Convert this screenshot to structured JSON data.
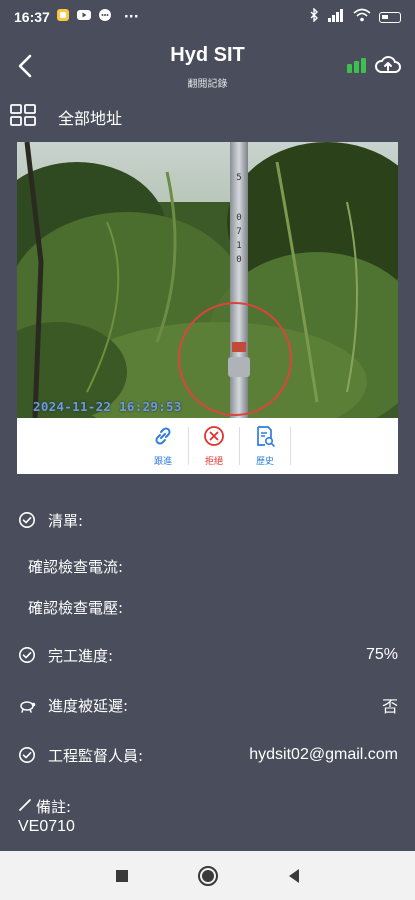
{
  "status_bar": {
    "time": "16:37",
    "more_indicator": "···",
    "icons": [
      "notification-app-icon",
      "youtube-icon",
      "chat-icon",
      "bluetooth-icon",
      "cellular-signal-icon",
      "wifi-icon",
      "battery-icon"
    ],
    "battery_level": "low"
  },
  "header": {
    "title": "Hyd SIT",
    "subtitle": "翻閱記錄",
    "signal_color": "#3fbf4f"
  },
  "filter": {
    "label": "全部地址"
  },
  "photo": {
    "timestamp": "2024-11-22 16:29:53",
    "marker_color": "#d9453a"
  },
  "actions": [
    {
      "label": "跟進",
      "color": "#2f7de1",
      "icon": "link-icon"
    },
    {
      "label": "拒絕",
      "color": "#e0322f",
      "icon": "reject-icon"
    },
    {
      "label": "歷史",
      "color": "#2f7de1",
      "icon": "history-icon"
    }
  ],
  "details": {
    "checklist_label": "清單:",
    "checklist_items": [
      "確認檢查電流:",
      "確認檢查電壓:"
    ],
    "progress_label": "完工進度:",
    "progress_value": "75%",
    "delay_label": "進度被延遲:",
    "delay_value": "否",
    "supervisor_label": "工程監督人員:",
    "supervisor_value": "hydsit02@gmail.com",
    "notes_label": "備註:",
    "notes_value": "VE0710"
  }
}
